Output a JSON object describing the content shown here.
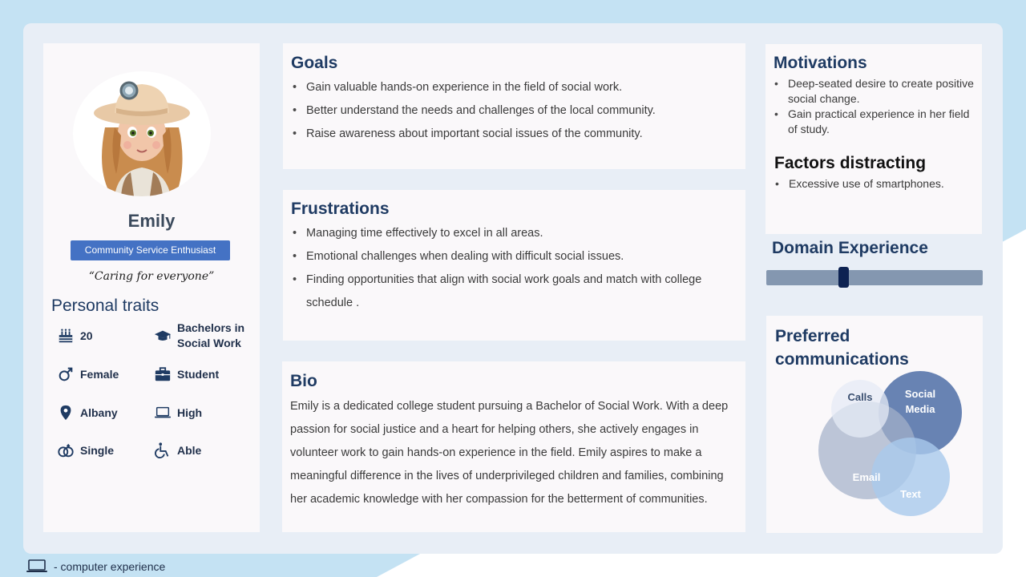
{
  "profile": {
    "name": "Emily",
    "role": "Community Service Enthusiast",
    "quote": "“Caring for everyone”",
    "traits_title": "Personal traits",
    "traits": {
      "age": "20",
      "education_line1": "Bachelors in",
      "education_line2": "Social Work",
      "gender": "Female",
      "occupation": "Student",
      "location": "Albany",
      "computer": "High",
      "relationship": "Single",
      "ability": "Able"
    }
  },
  "goals": {
    "title": "Goals",
    "items": [
      "Gain valuable hands-on experience in the field of social work.",
      "Better understand the needs and challenges of the local community.",
      "Raise awareness about important social issues of the community."
    ]
  },
  "frustrations": {
    "title": "Frustrations",
    "items": [
      "Managing time effectively to excel in all areas.",
      "Emotional challenges when dealing with difficult social issues.",
      "Finding opportunities that align with social work goals and match with college schedule ."
    ]
  },
  "bio": {
    "title": "Bio",
    "text": "Emily is a dedicated college student pursuing a Bachelor of Social Work. With a deep passion for social justice and a heart for helping others, she actively engages in volunteer work to gain hands-on experience in the field. Emily aspires to make a meaningful difference in the lives of underprivileged children and families, combining her academic knowledge with her compassion for the betterment of communities."
  },
  "motivations": {
    "title": "Motivations",
    "items": [
      "Deep-seated desire to create positive social change.",
      "Gain practical experience in her field of study."
    ]
  },
  "factors": {
    "title": "Factors distracting",
    "items": [
      "Excessive use of smartphones."
    ]
  },
  "domain_experience": {
    "title": "Domain Experience",
    "level": 0.35
  },
  "preferred_comms": {
    "title": "Preferred communications",
    "labels": {
      "calls": "Calls",
      "social_line1": "Social",
      "social_line2": "Media",
      "email": "Email",
      "text": "Text"
    }
  },
  "footer": {
    "legend": "- computer experience",
    "icon": "laptop-icon"
  },
  "colors": {
    "page_bg": "#c4e2f3",
    "frame_bg": "#e8eef6",
    "card_bg": "#faf8fa",
    "accent": "#4472c4",
    "title": "#1f3b63",
    "slider_track": "#8497b0",
    "slider_thumb": "#0d2252"
  }
}
